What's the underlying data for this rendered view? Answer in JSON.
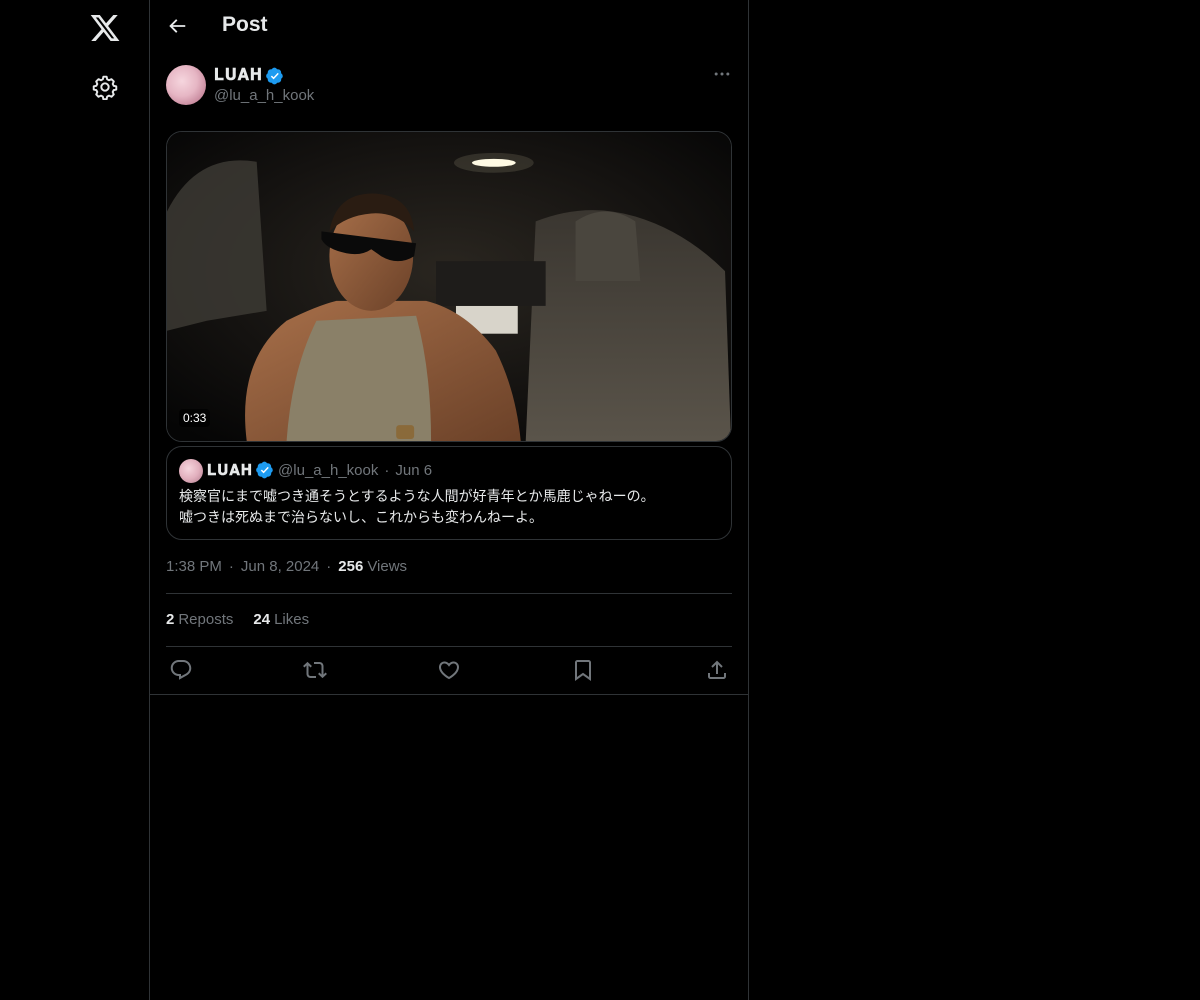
{
  "header": {
    "title": "Post"
  },
  "tweet": {
    "author_name": "𝐋𝐔𝐀𝐇",
    "author_handle": "@lu_a_h_kook",
    "media": {
      "duration": "0:33"
    },
    "quote": {
      "author_name": "𝐋𝐔𝐀𝐇",
      "author_handle": "@lu_a_h_kook",
      "separator": "·",
      "date": "Jun 6",
      "text_line1": "検察官にまで嘘つき通そうとするような人間が好青年とか馬鹿じゃねーの。",
      "text_line2": "嘘つきは死ぬまで治らないし、これからも変わんねーよ。"
    },
    "time": "1:38 PM",
    "date": "Jun 8, 2024",
    "separator": "·",
    "views_count": "256",
    "views_label": "Views",
    "reposts_count": "2",
    "reposts_label": "Reposts",
    "likes_count": "24",
    "likes_label": "Likes"
  },
  "icons": {
    "logo": "x-logo-icon",
    "settings": "gear-icon",
    "back": "arrow-left-icon",
    "more": "more-horizontal-icon",
    "verified": "verified-badge-icon",
    "reply": "reply-icon",
    "repost": "repost-icon",
    "like": "heart-icon",
    "bookmark": "bookmark-icon",
    "share": "share-icon"
  },
  "colors": {
    "background": "#000000",
    "text": "#e7e9ea",
    "muted": "#71767b",
    "border": "#2f3336",
    "verified": "#1d9bf0"
  }
}
